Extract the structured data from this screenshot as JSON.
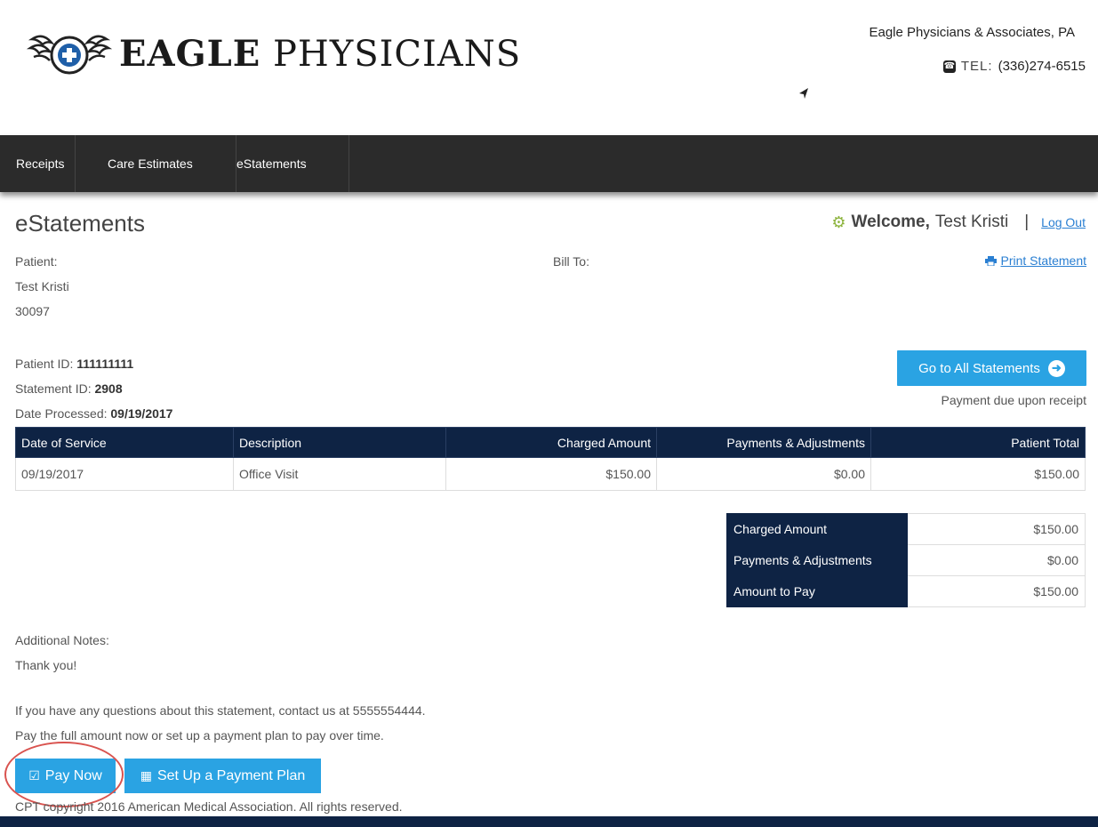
{
  "header": {
    "logo_bold": "EAGLE",
    "logo_light": "PHYSICIANS",
    "org_name": "Eagle Physicians & Associates, PA",
    "tel_label": "TEL:",
    "tel_number": "(336)274-6515"
  },
  "nav": {
    "items": [
      {
        "label": "Receipts"
      },
      {
        "label": "Care Estimates"
      },
      {
        "label": "eStatements"
      }
    ]
  },
  "page": {
    "title": "eStatements",
    "welcome_label": "Welcome,",
    "welcome_user": "Test Kristi",
    "separator": "|",
    "logout": "Log Out",
    "print_statement": "Print Statement"
  },
  "patient": {
    "label": "Patient:",
    "name": "Test Kristi",
    "zip": "30097",
    "bill_to_label": "Bill To:",
    "patient_id_label": "Patient ID:",
    "patient_id": "111111111",
    "statement_id_label": "Statement ID:",
    "statement_id": "2908",
    "date_processed_label": "Date Processed:",
    "date_processed": "09/19/2017"
  },
  "actions": {
    "go_all": "Go to All Statements",
    "payment_due": "Payment due upon receipt",
    "pay_now": "Pay Now",
    "payment_plan": "Set Up a Payment Plan"
  },
  "table": {
    "headers": [
      "Date of Service",
      "Description",
      "Charged Amount",
      "Payments & Adjustments",
      "Patient Total"
    ],
    "rows": [
      [
        "09/19/2017",
        "Office Visit",
        "$150.00",
        "$0.00",
        "$150.00"
      ]
    ]
  },
  "summary": [
    {
      "label": "Charged Amount",
      "value": "$150.00"
    },
    {
      "label": "Payments & Adjustments",
      "value": "$0.00"
    },
    {
      "label": "Amount to Pay",
      "value": "$150.00"
    }
  ],
  "notes": {
    "label": "Additional Notes:",
    "text": "Thank you!",
    "questions": "If you have any questions about this statement, contact us at 5555554444.",
    "pay_info": "Pay the full amount now or set up a payment plan to pay over time."
  },
  "footer": {
    "copyright": "CPT copyright 2016 American Medical Association. All rights reserved."
  },
  "colors": {
    "nav_bg": "#2b2b2b",
    "table_header": "#0e2344",
    "accent": "#2aa3e3",
    "link": "#2a7fd2",
    "highlight_circle": "#d9534f"
  }
}
